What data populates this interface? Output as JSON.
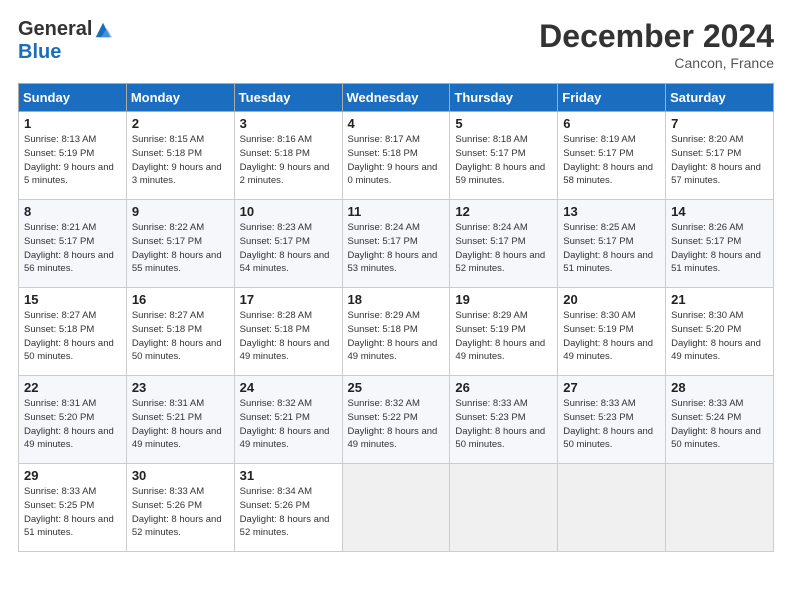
{
  "logo": {
    "general": "General",
    "blue": "Blue"
  },
  "title": "December 2024",
  "subtitle": "Cancon, France",
  "days_header": [
    "Sunday",
    "Monday",
    "Tuesday",
    "Wednesday",
    "Thursday",
    "Friday",
    "Saturday"
  ],
  "weeks": [
    [
      {
        "num": "1",
        "sunrise": "8:13 AM",
        "sunset": "5:19 PM",
        "daylight": "9 hours and 5 minutes."
      },
      {
        "num": "2",
        "sunrise": "8:15 AM",
        "sunset": "5:18 PM",
        "daylight": "9 hours and 3 minutes."
      },
      {
        "num": "3",
        "sunrise": "8:16 AM",
        "sunset": "5:18 PM",
        "daylight": "9 hours and 2 minutes."
      },
      {
        "num": "4",
        "sunrise": "8:17 AM",
        "sunset": "5:18 PM",
        "daylight": "9 hours and 0 minutes."
      },
      {
        "num": "5",
        "sunrise": "8:18 AM",
        "sunset": "5:17 PM",
        "daylight": "8 hours and 59 minutes."
      },
      {
        "num": "6",
        "sunrise": "8:19 AM",
        "sunset": "5:17 PM",
        "daylight": "8 hours and 58 minutes."
      },
      {
        "num": "7",
        "sunrise": "8:20 AM",
        "sunset": "5:17 PM",
        "daylight": "8 hours and 57 minutes."
      }
    ],
    [
      {
        "num": "8",
        "sunrise": "8:21 AM",
        "sunset": "5:17 PM",
        "daylight": "8 hours and 56 minutes."
      },
      {
        "num": "9",
        "sunrise": "8:22 AM",
        "sunset": "5:17 PM",
        "daylight": "8 hours and 55 minutes."
      },
      {
        "num": "10",
        "sunrise": "8:23 AM",
        "sunset": "5:17 PM",
        "daylight": "8 hours and 54 minutes."
      },
      {
        "num": "11",
        "sunrise": "8:24 AM",
        "sunset": "5:17 PM",
        "daylight": "8 hours and 53 minutes."
      },
      {
        "num": "12",
        "sunrise": "8:24 AM",
        "sunset": "5:17 PM",
        "daylight": "8 hours and 52 minutes."
      },
      {
        "num": "13",
        "sunrise": "8:25 AM",
        "sunset": "5:17 PM",
        "daylight": "8 hours and 51 minutes."
      },
      {
        "num": "14",
        "sunrise": "8:26 AM",
        "sunset": "5:17 PM",
        "daylight": "8 hours and 51 minutes."
      }
    ],
    [
      {
        "num": "15",
        "sunrise": "8:27 AM",
        "sunset": "5:18 PM",
        "daylight": "8 hours and 50 minutes."
      },
      {
        "num": "16",
        "sunrise": "8:27 AM",
        "sunset": "5:18 PM",
        "daylight": "8 hours and 50 minutes."
      },
      {
        "num": "17",
        "sunrise": "8:28 AM",
        "sunset": "5:18 PM",
        "daylight": "8 hours and 49 minutes."
      },
      {
        "num": "18",
        "sunrise": "8:29 AM",
        "sunset": "5:18 PM",
        "daylight": "8 hours and 49 minutes."
      },
      {
        "num": "19",
        "sunrise": "8:29 AM",
        "sunset": "5:19 PM",
        "daylight": "8 hours and 49 minutes."
      },
      {
        "num": "20",
        "sunrise": "8:30 AM",
        "sunset": "5:19 PM",
        "daylight": "8 hours and 49 minutes."
      },
      {
        "num": "21",
        "sunrise": "8:30 AM",
        "sunset": "5:20 PM",
        "daylight": "8 hours and 49 minutes."
      }
    ],
    [
      {
        "num": "22",
        "sunrise": "8:31 AM",
        "sunset": "5:20 PM",
        "daylight": "8 hours and 49 minutes."
      },
      {
        "num": "23",
        "sunrise": "8:31 AM",
        "sunset": "5:21 PM",
        "daylight": "8 hours and 49 minutes."
      },
      {
        "num": "24",
        "sunrise": "8:32 AM",
        "sunset": "5:21 PM",
        "daylight": "8 hours and 49 minutes."
      },
      {
        "num": "25",
        "sunrise": "8:32 AM",
        "sunset": "5:22 PM",
        "daylight": "8 hours and 49 minutes."
      },
      {
        "num": "26",
        "sunrise": "8:33 AM",
        "sunset": "5:23 PM",
        "daylight": "8 hours and 50 minutes."
      },
      {
        "num": "27",
        "sunrise": "8:33 AM",
        "sunset": "5:23 PM",
        "daylight": "8 hours and 50 minutes."
      },
      {
        "num": "28",
        "sunrise": "8:33 AM",
        "sunset": "5:24 PM",
        "daylight": "8 hours and 50 minutes."
      }
    ],
    [
      {
        "num": "29",
        "sunrise": "8:33 AM",
        "sunset": "5:25 PM",
        "daylight": "8 hours and 51 minutes."
      },
      {
        "num": "30",
        "sunrise": "8:33 AM",
        "sunset": "5:26 PM",
        "daylight": "8 hours and 52 minutes."
      },
      {
        "num": "31",
        "sunrise": "8:34 AM",
        "sunset": "5:26 PM",
        "daylight": "8 hours and 52 minutes."
      },
      null,
      null,
      null,
      null
    ]
  ]
}
